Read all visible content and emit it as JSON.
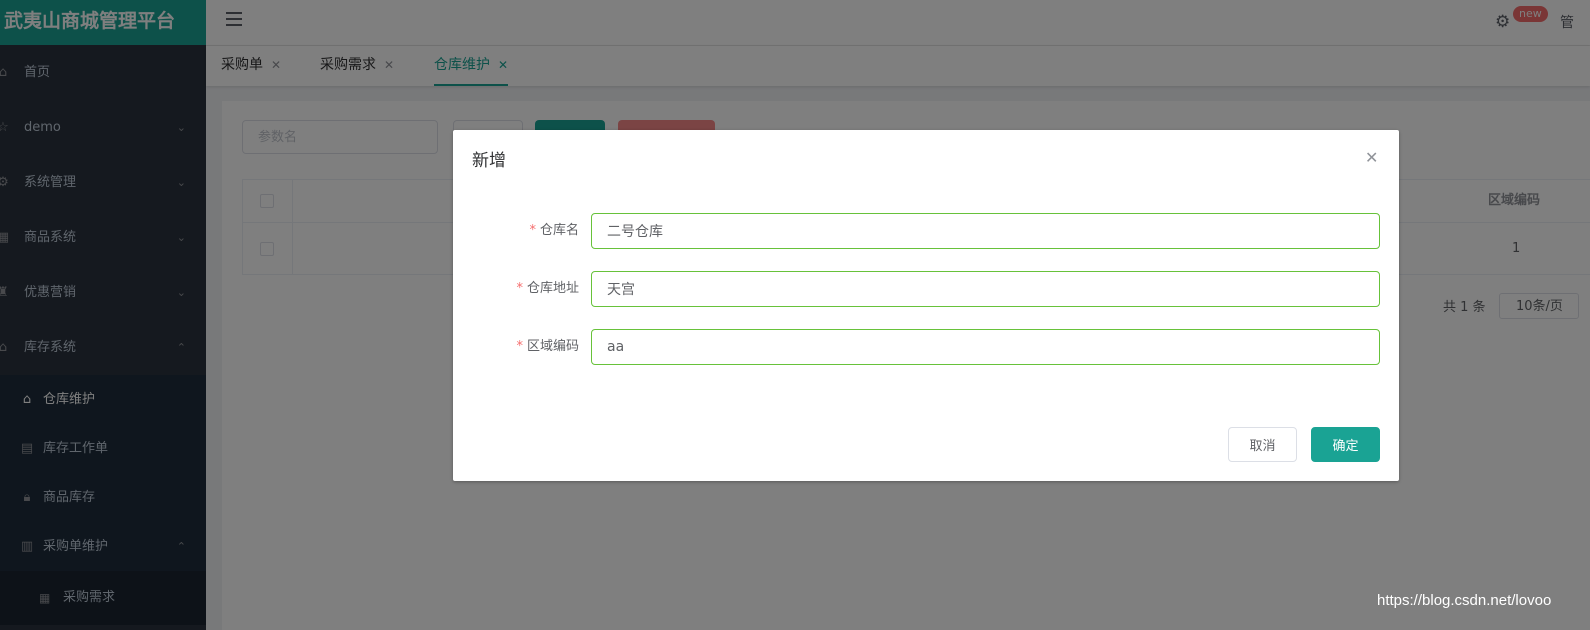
{
  "app": {
    "title": "武夷山商城管理平台"
  },
  "sidebar": {
    "items": [
      {
        "label": "首页",
        "icon": "home-icon"
      },
      {
        "label": "demo",
        "icon": "star-icon"
      },
      {
        "label": "系统管理",
        "icon": "gear-icon"
      },
      {
        "label": "商品系统",
        "icon": "grid-icon"
      },
      {
        "label": "优惠营销",
        "icon": "trophy-icon"
      },
      {
        "label": "库存系统",
        "icon": "home-icon"
      }
    ],
    "sub_items": [
      {
        "label": "仓库维护",
        "icon": "home-icon",
        "active": true
      },
      {
        "label": "库存工作单",
        "icon": "document-icon"
      },
      {
        "label": "商品库存",
        "icon": "lock-icon"
      },
      {
        "label": "采购单维护",
        "icon": "chart-icon"
      }
    ],
    "sub2_items": [
      {
        "label": "采购需求",
        "icon": "grid-icon"
      }
    ]
  },
  "header": {
    "badge": "new",
    "cut_text": "管"
  },
  "tabs": [
    {
      "label": "采购单"
    },
    {
      "label": "采购需求"
    },
    {
      "label": "仓库维护",
      "active": true
    }
  ],
  "content": {
    "search_placeholder": "参数名",
    "table": {
      "visible_header": "区域编码",
      "rows": [
        {
          "region_code": "1"
        }
      ]
    },
    "pager": {
      "total": "共 1 条",
      "page_size": "10条/页"
    }
  },
  "dialog": {
    "title": "新增",
    "fields": [
      {
        "label": "仓库名",
        "value": "二号仓库",
        "required": true
      },
      {
        "label": "仓库地址",
        "value": "天宫",
        "required": true
      },
      {
        "label": "区域编码",
        "value": "aa",
        "required": true
      }
    ],
    "cancel_label": "取消",
    "confirm_label": "确定"
  },
  "watermark": "https://blog.csdn.net/lovoo",
  "colors": {
    "accent": "#1aa394",
    "sidebar_bg": "#2b333e",
    "danger": "#f56c6c",
    "valid_border": "#67c23a"
  }
}
